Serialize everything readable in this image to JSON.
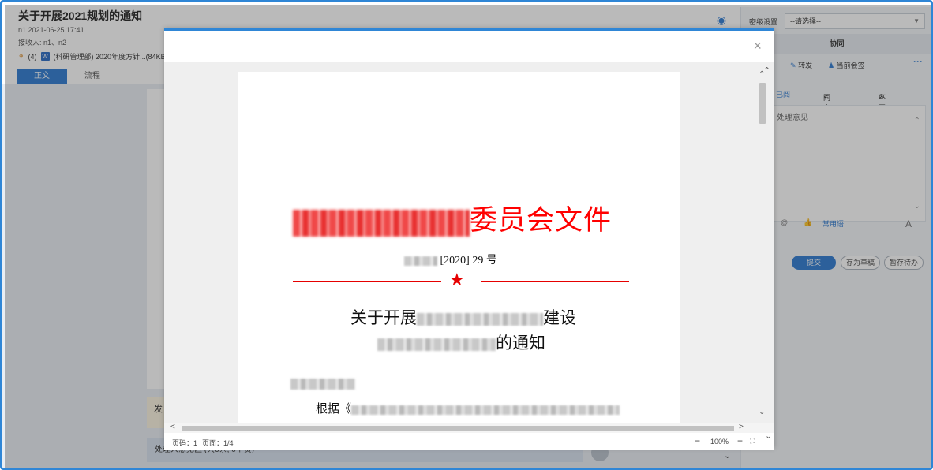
{
  "header": {
    "title": "关于开展2021规划的通知",
    "meta": "n1   2021-06-25 17:41",
    "recipients": "接收人:   n1、n2",
    "attachment_count": "(4)",
    "attachment_name": "(科研管理部) 2020年度方针...(84KB)"
  },
  "tabs": [
    {
      "label": "正文"
    },
    {
      "label": "流程"
    }
  ],
  "left": {
    "fa_label": "发",
    "opinion_bar": "处理人意见区 (共0条, 0个赞)"
  },
  "right": {
    "secret_label": "密级设置:",
    "secret_select": "--请选择--",
    "collab_label": "协同",
    "forward_label": "转发",
    "countersign_label": "当前会签",
    "more_label": "···",
    "opinion_tabs": [
      "已阅",
      "同意",
      "不同意"
    ],
    "opinion_placeholder": "处理意见",
    "tools": {
      "mention": "@",
      "like": "👍",
      "phrases": "常用语",
      "font": "A"
    },
    "buttons": {
      "submit": "提交",
      "draft": "存为草稿",
      "hold": "暂存待办"
    }
  },
  "modal": {
    "close": "×",
    "document": {
      "header_suffix": "委员会文件",
      "number_text": "[2020] 29 号",
      "star": "★",
      "title_prefix": "关于开展",
      "title_suffix1": "建设",
      "title_suffix2": "的通知",
      "body_prefix": "根据《"
    },
    "status": {
      "page_no": "页码：1",
      "page_count": "页面：1/4",
      "zoom_minus": "−",
      "zoom": "100%",
      "zoom_plus": "+",
      "fit": "⛶"
    }
  }
}
